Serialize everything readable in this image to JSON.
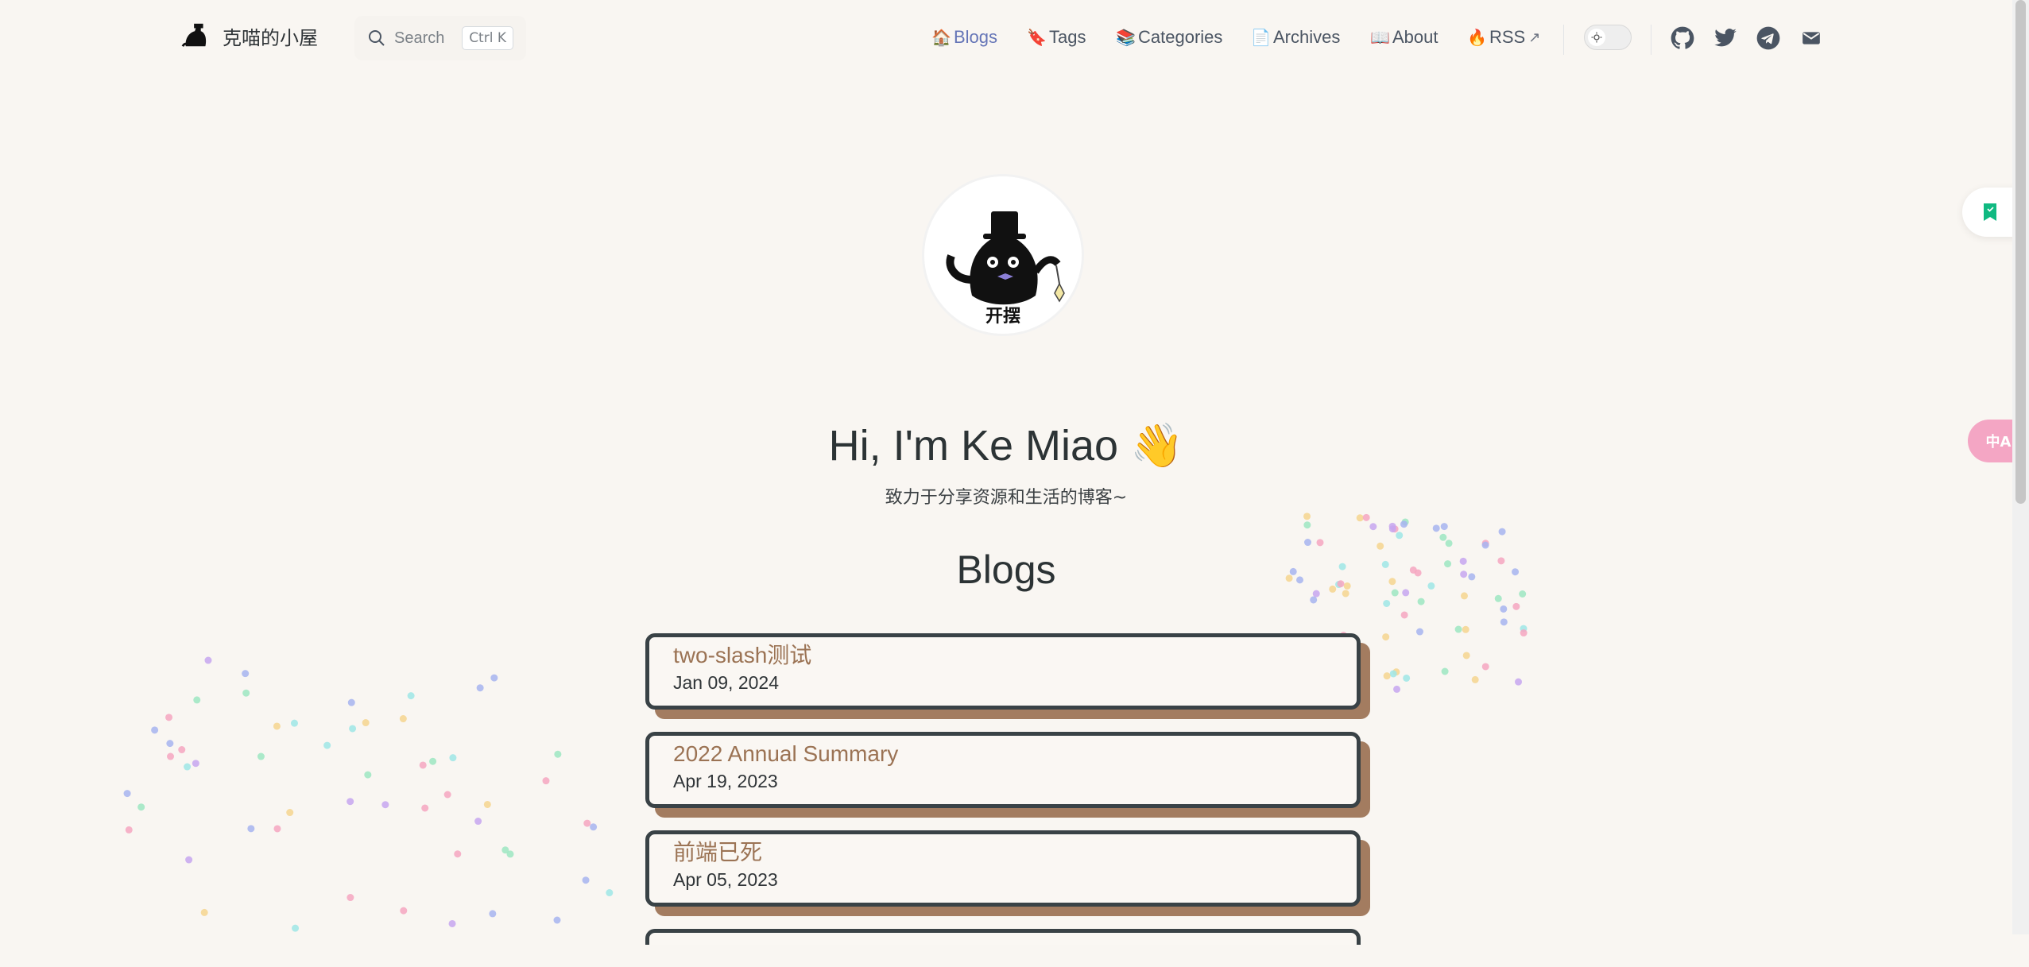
{
  "brand": {
    "title": "克喵的小屋"
  },
  "search": {
    "placeholder": "Search",
    "shortcut": "Ctrl K"
  },
  "nav": [
    {
      "label": "Blogs",
      "emoji": "🏠",
      "active": true
    },
    {
      "label": "Tags",
      "emoji": "🔖"
    },
    {
      "label": "Categories",
      "emoji": "📚"
    },
    {
      "label": "Archives",
      "emoji": "📄"
    },
    {
      "label": "About",
      "emoji": "📖"
    },
    {
      "label": "RSS",
      "emoji": "🔥",
      "external": "↗"
    }
  ],
  "social": [
    "github-icon",
    "twitter-icon",
    "telegram-icon",
    "mail-icon"
  ],
  "avatar": {
    "caption": "开摆"
  },
  "hero": {
    "title": "Hi, I'm Ke Miao 👋",
    "subtitle": "致力于分享资源和生活的博客~"
  },
  "section": {
    "title": "Blogs"
  },
  "posts": [
    {
      "title": "two-slash测试",
      "date": "Jan 09, 2024"
    },
    {
      "title": "2022 Annual Summary",
      "date": "Apr 19, 2023"
    },
    {
      "title": "前端已死",
      "date": "Apr 05, 2023"
    }
  ],
  "translate": {
    "label": "中A"
  },
  "colors": {
    "accent": "#6575b7",
    "card_border": "#394246",
    "card_shadow": "#a37c60",
    "title_brown": "#9b7354",
    "background": "#f9f6f2"
  }
}
